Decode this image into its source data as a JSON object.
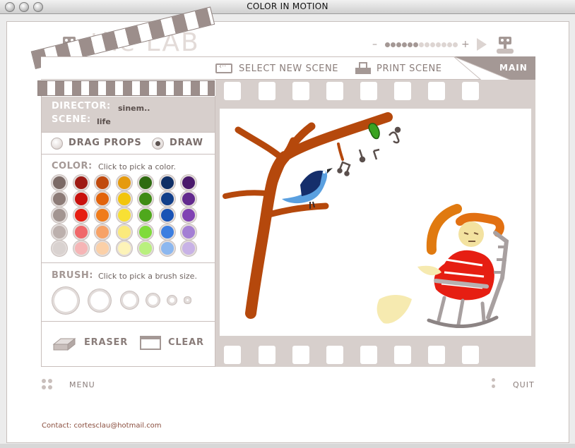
{
  "window": {
    "title": "COLOR IN MOTION"
  },
  "logo": {
    "text": "the LAB"
  },
  "nav": {
    "select_scene": "SELECT NEW SCENE",
    "print_scene": "PRINT SCENE",
    "main": "MAIN"
  },
  "volume": {
    "minus": "–",
    "plus": "+",
    "level": 0.45
  },
  "scene_info": {
    "director_label": "DIRECTOR:",
    "director_value": "sinem..",
    "scene_label": "SCENE:",
    "scene_value": "life"
  },
  "mode": {
    "drag_label": "DRAG PROPS",
    "draw_label": "DRAW",
    "selected": "draw"
  },
  "color": {
    "title": "COLOR:",
    "hint": "Click to pick a color.",
    "palette": [
      [
        "#7b6a66",
        "#9e1a14",
        "#c04a0e",
        "#e59a0d",
        "#2f6b11",
        "#0f2f66",
        "#4a1a6b"
      ],
      [
        "#8c7b77",
        "#c9110d",
        "#e2630b",
        "#f2c50d",
        "#3e8a14",
        "#123f8a",
        "#632a8e"
      ],
      [
        "#a39591",
        "#e61e12",
        "#f07c1b",
        "#f8e034",
        "#4fa81c",
        "#1953b5",
        "#8142b3"
      ],
      [
        "#bcb0ad",
        "#f0686a",
        "#f7a266",
        "#fbea7c",
        "#7fdb3a",
        "#3c7ee0",
        "#a47fd4"
      ],
      [
        "#d9d2d0",
        "#f6b5b6",
        "#fbd0a8",
        "#fdf3b8",
        "#b9f07e",
        "#8cb7ef",
        "#c8b2e6"
      ]
    ]
  },
  "brush": {
    "title": "BRUSH:",
    "hint": "Click to pick a brush size."
  },
  "tools": {
    "eraser": "ERASER",
    "clear": "CLEAR"
  },
  "footer": {
    "menu": "MENU",
    "quit": "QUIT",
    "contact": "Contact: cortesclau@hotmail.com"
  },
  "colors": {
    "accent": "#a49895",
    "panel": "#d7cfcc",
    "branch": "#b5480c"
  }
}
